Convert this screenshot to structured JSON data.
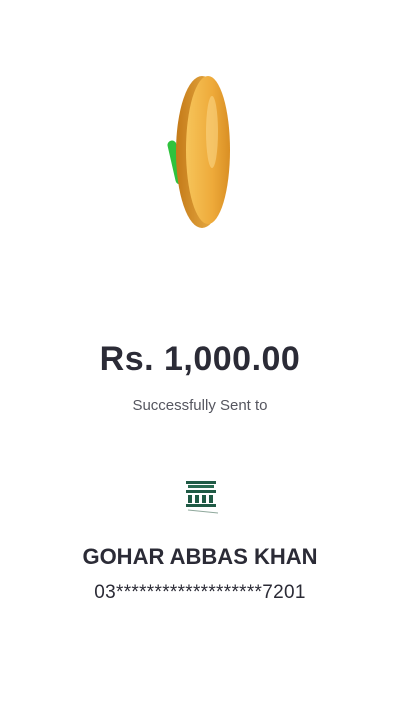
{
  "transfer": {
    "amount": "Rs. 1,000.00",
    "status_text": "Successfully Sent to"
  },
  "recipient": {
    "name": "GOHAR ABBAS KHAN",
    "account": "03*******************7201",
    "bank_icon": "bank-building-icon"
  },
  "illustration": {
    "icon": "coin-checkmark-icon"
  },
  "colors": {
    "coin": "#f0b040",
    "check": "#33cc44",
    "bank": "#1f5a45",
    "text": "#2b2b36"
  }
}
